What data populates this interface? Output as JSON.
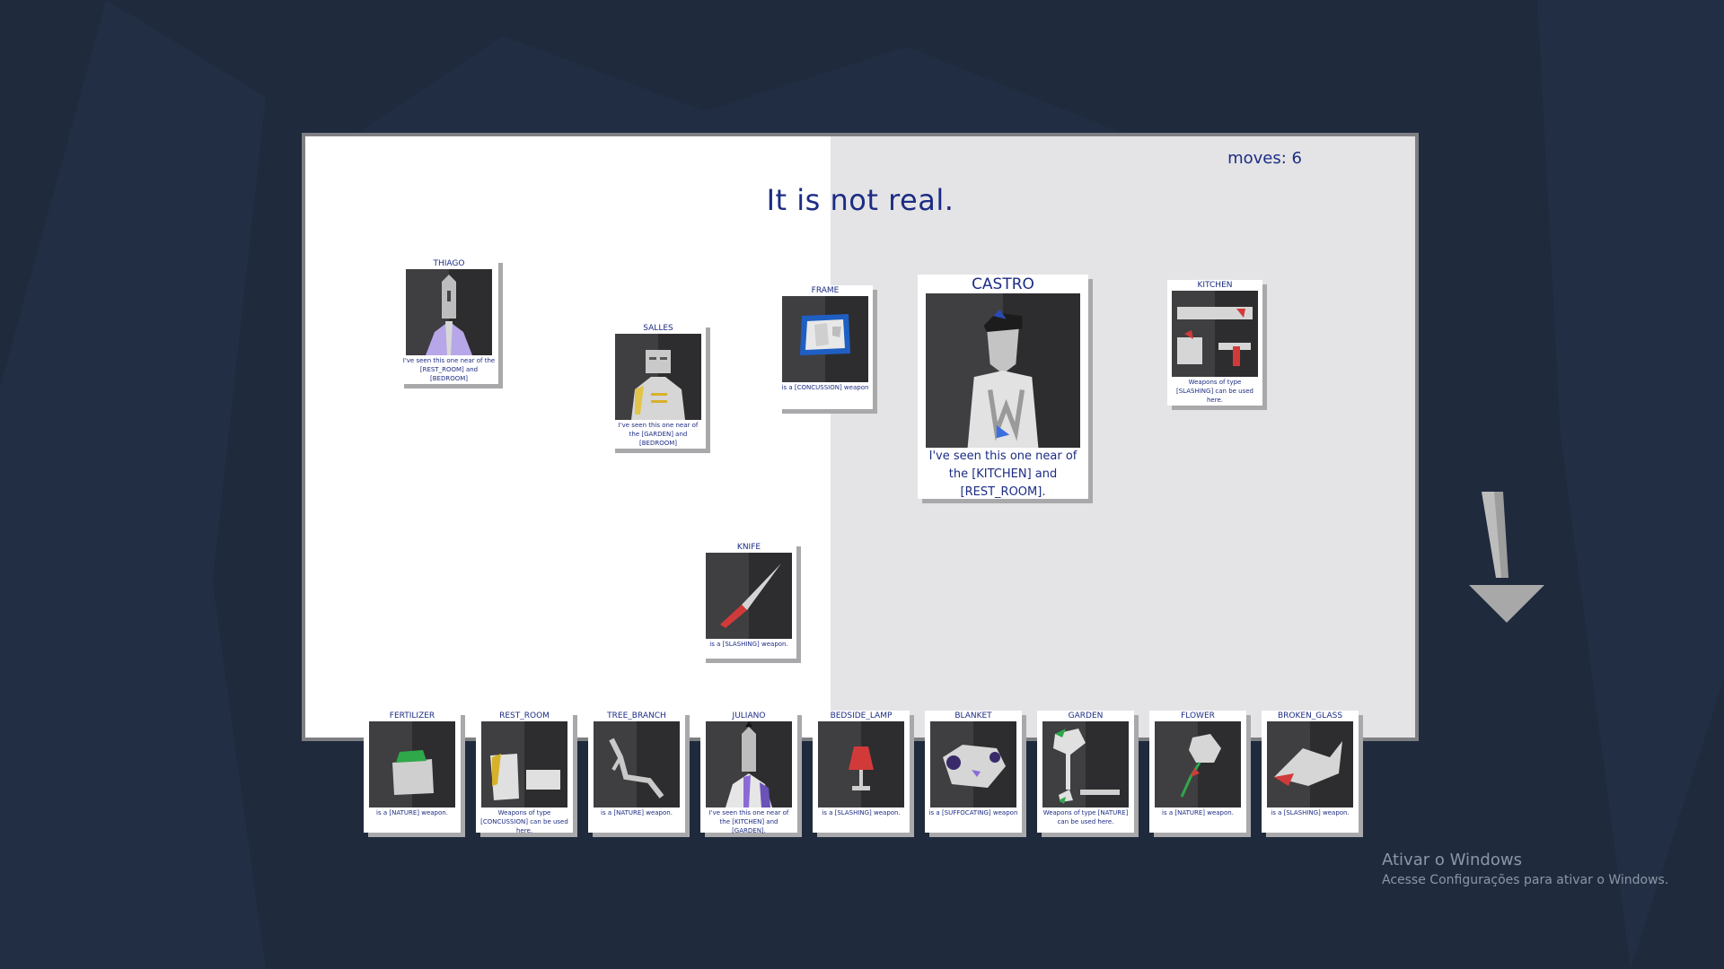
{
  "board": {
    "moves_label": "moves: 6",
    "headline": "It is not real."
  },
  "board_cards": [
    {
      "name": "THIAGO",
      "desc": "I've seen this one near of the [REST_ROOM] and [BEDROOM]"
    },
    {
      "name": "SALLES",
      "desc": "I've seen this one near of the [GARDEN] and [BEDROOM]"
    },
    {
      "name": "FRAME",
      "desc": "is a [CONCUSSION] weapon"
    },
    {
      "name": "CASTRO",
      "desc": "I've seen this one near of the [KITCHEN] and [REST_ROOM]."
    },
    {
      "name": "KITCHEN",
      "desc": "Weapons of type [SLASHING] can be used here."
    },
    {
      "name": "KNIFE",
      "desc": "is a [SLASHING] weapon."
    }
  ],
  "hand_cards": [
    {
      "name": "FERTILIZER",
      "desc": "is a [NATURE] weapon."
    },
    {
      "name": "REST_ROOM",
      "desc": "Weapons of type [CONCUSSION] can be used here."
    },
    {
      "name": "TREE_BRANCH",
      "desc": "is a [NATURE] weapon."
    },
    {
      "name": "JULIANO",
      "desc": "I've seen this one near of the [KITCHEN] and [GARDEN]."
    },
    {
      "name": "BEDSIDE_LAMP",
      "desc": "is a [SLASHING] weapon."
    },
    {
      "name": "BLANKET",
      "desc": "is a [SUFFOCATING] weapon"
    },
    {
      "name": "GARDEN",
      "desc": "Weapons of type [NATURE] can be used here."
    },
    {
      "name": "FLOWER",
      "desc": "is a [NATURE] weapon."
    },
    {
      "name": "BROKEN_GLASS",
      "desc": "is a [SLASHING] weapon."
    }
  ],
  "watermark": {
    "title": "Ativar o Windows",
    "subtitle": "Acesse Configurações para ativar o Windows."
  },
  "icons": {
    "arrow": "down-arrow-icon"
  },
  "colors": {
    "background": "#1f2a3d",
    "text": "#1c2c84",
    "board_left": "#ffffff",
    "board_right": "#e4e4e6"
  }
}
